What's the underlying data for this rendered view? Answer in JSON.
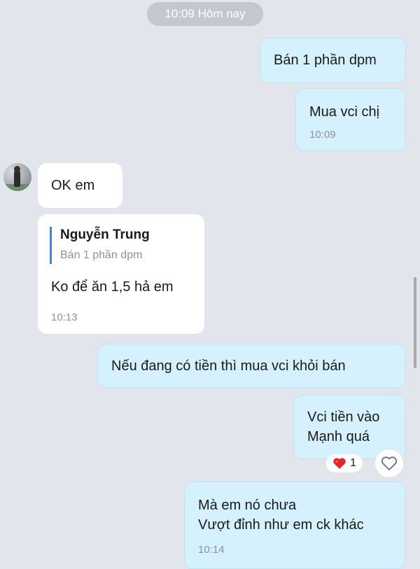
{
  "header": {
    "time_label": "10:09 Hôm nay"
  },
  "messages": [
    {
      "text": "Bán 1 phần dpm"
    },
    {
      "text": "Mua vci chị",
      "time": "10:09"
    },
    {
      "text": "OK em"
    },
    {
      "reply_to": {
        "name": "Nguyễn Trung",
        "text": "Bán 1 phần dpm"
      },
      "text": "Ko để ăn 1,5 hả em",
      "time": "10:13"
    },
    {
      "text": "Nếu đang có tiền thì mua vci khỏi bán"
    },
    {
      "lines": [
        "Vci tiền vào",
        "Mạnh quá"
      ],
      "reaction": {
        "emoji": "❤️",
        "count": "1"
      }
    },
    {
      "lines": [
        "Mà em nó chưa",
        "Vượt đỉnh như em ck khác"
      ],
      "time": "10:14"
    }
  ],
  "colors": {
    "background": "#e2e5ec",
    "outgoing": "#d5f1fd",
    "incoming": "#ffffff",
    "quote_bar": "#2e8ae6",
    "heart": "#e0262b"
  },
  "icons": {
    "react": "heart-outline-icon",
    "reaction": "heart-icon"
  }
}
